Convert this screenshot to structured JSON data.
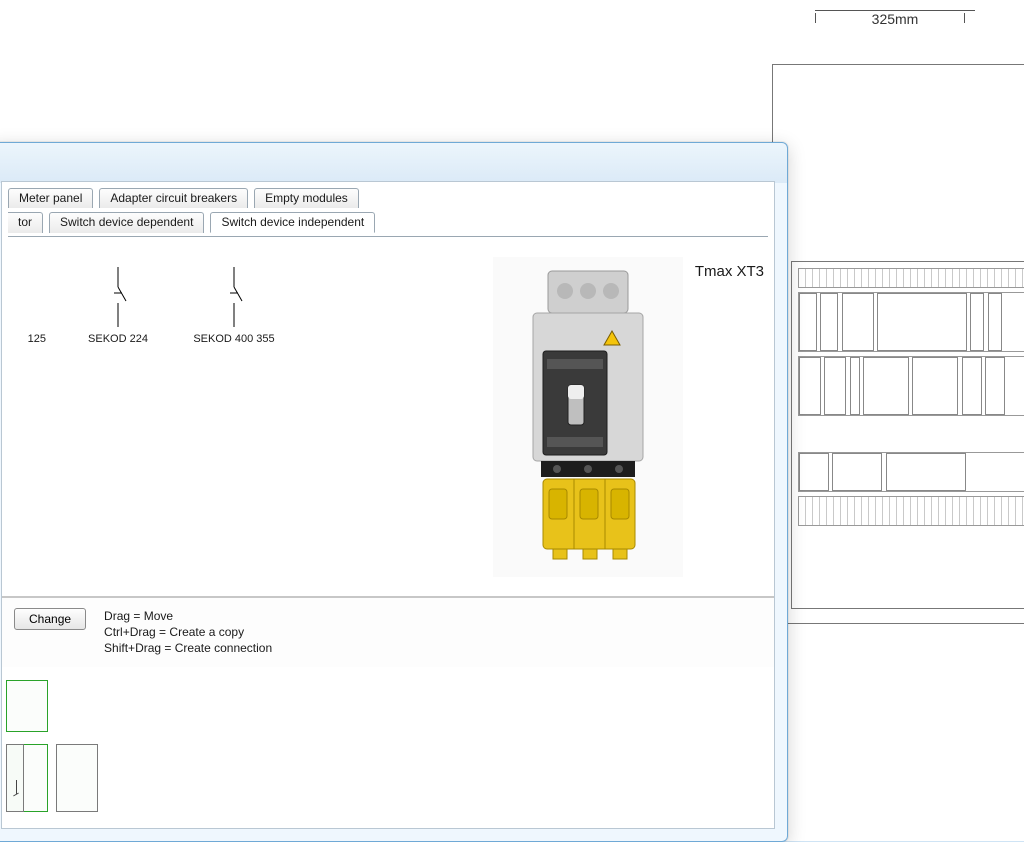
{
  "drawing": {
    "dimension_label": "325mm"
  },
  "window": {
    "tabs_top": [
      {
        "label": "Meter panel"
      },
      {
        "label": "Adapter circuit breakers"
      },
      {
        "label": "Empty modules"
      }
    ],
    "tabs_bottom": [
      {
        "label": "tor",
        "partial": true
      },
      {
        "label": "Switch device dependent"
      },
      {
        "label": "Switch device independent",
        "active": true
      }
    ],
    "symbols": [
      {
        "label": "125",
        "partial": true
      },
      {
        "label": "SEKOD 224"
      },
      {
        "label": "SEKOD 400 355"
      }
    ],
    "preview_title": "Tmax XT3",
    "change_button": "Change",
    "hints": [
      "Drag = Move",
      "Ctrl+Drag = Create a copy",
      "Shift+Drag = Create connection"
    ]
  }
}
